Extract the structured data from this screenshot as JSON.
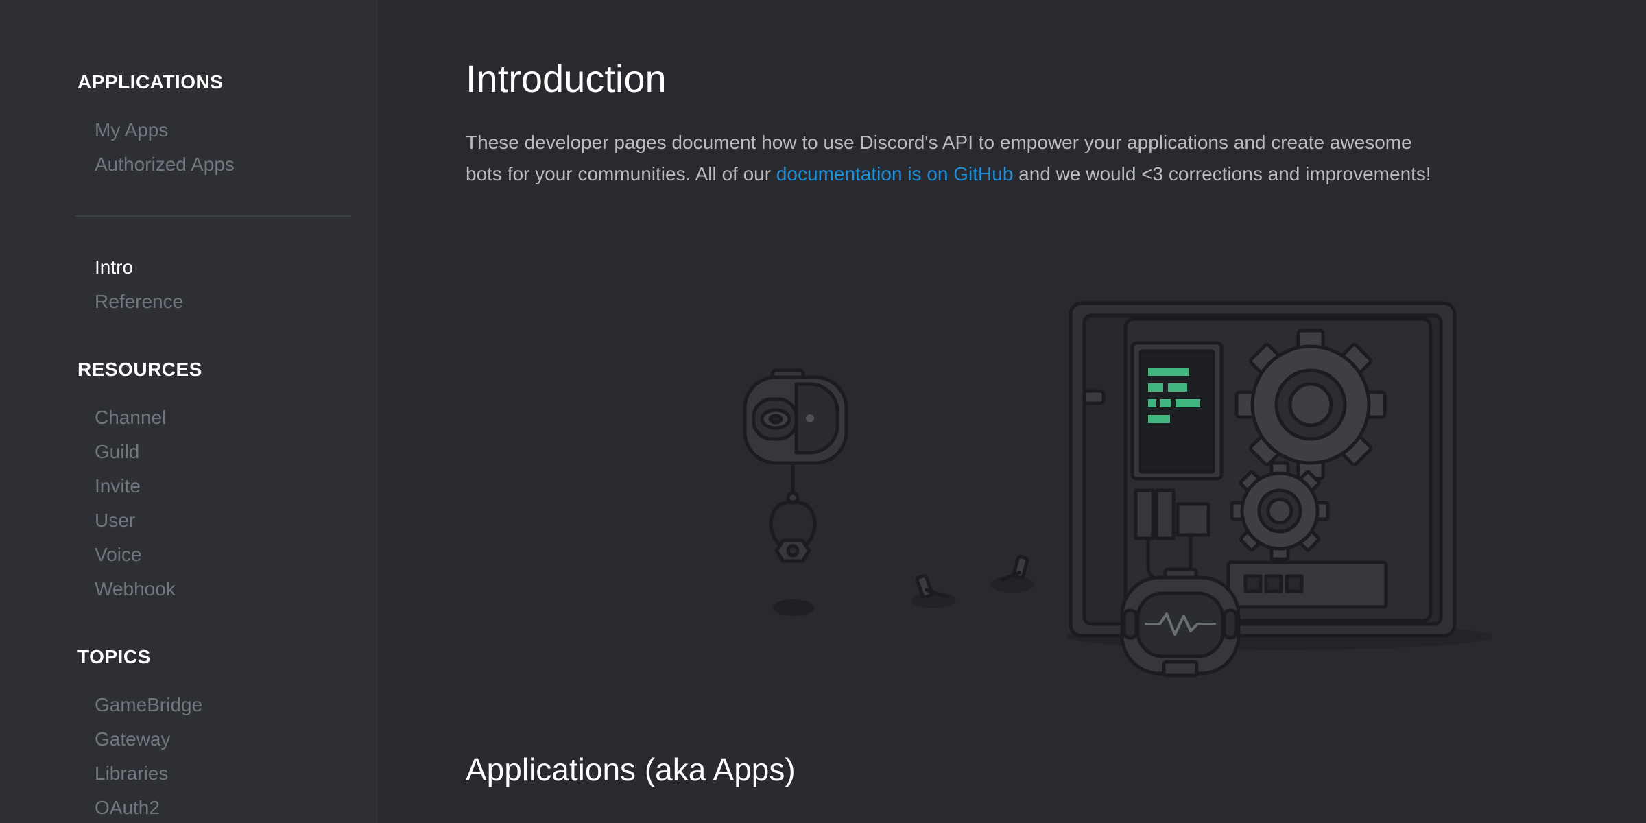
{
  "sidebar": {
    "sections": [
      {
        "title": "APPLICATIONS",
        "items": [
          "My Apps",
          "Authorized Apps"
        ]
      },
      {
        "title": "",
        "items": [
          "Intro",
          "Reference"
        ]
      },
      {
        "title": "RESOURCES",
        "items": [
          "Channel",
          "Guild",
          "Invite",
          "User",
          "Voice",
          "Webhook"
        ]
      },
      {
        "title": "TOPICS",
        "items": [
          "GameBridge",
          "Gateway",
          "Libraries",
          "OAuth2"
        ]
      }
    ],
    "active_item": "Intro"
  },
  "main": {
    "title": "Introduction",
    "intro_before": "These developer pages document how to use Discord's API to empower your applications and create awesome bots for your communities. All of our ",
    "intro_link": "documentation is on GitHub",
    "intro_after": " and we would <3 corrections and improvements!",
    "subheading": "Applications (aka Apps)"
  },
  "colors": {
    "background": "#282a2f",
    "sidebar": "#2d2f34",
    "link": "#1f90d8",
    "code_green": "#43b581"
  },
  "icons": [
    "robot-head-icon",
    "robot-claw-icon",
    "screw-icon",
    "machine-box-icon",
    "gear-icon",
    "robot-face-icon"
  ]
}
